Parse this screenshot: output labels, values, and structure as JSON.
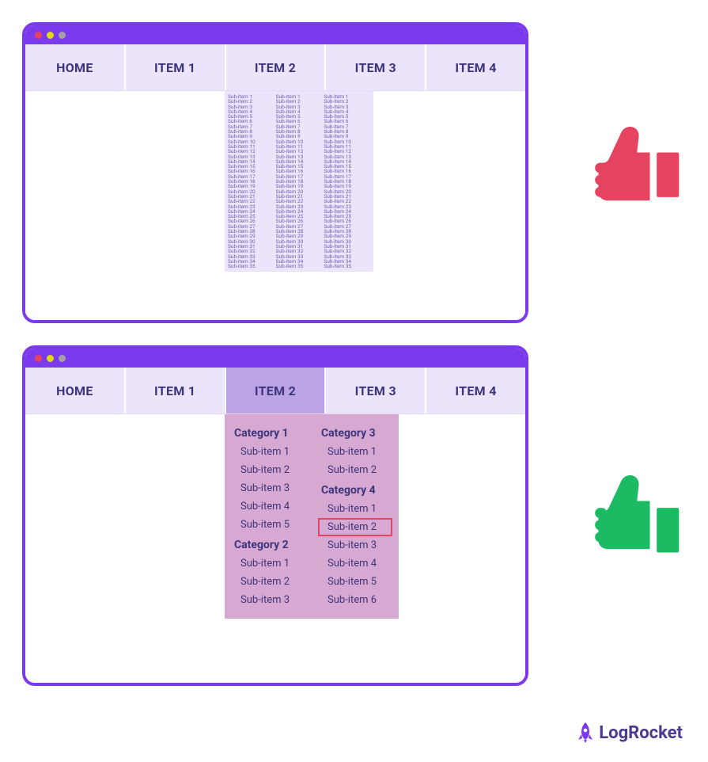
{
  "colors": {
    "window_border": "#7c3aed",
    "titlebar": "#7c3aed",
    "nav_bg": "#ece4fb",
    "nav_active": "#bba3e6",
    "nav_text": "#3d357a",
    "bad_dropdown_bg": "#ece4fb",
    "mega_bg": "#d7a8d2",
    "mega_text": "#3d357a",
    "highlight_border": "#e54360",
    "thumbs_down": "#e54360",
    "thumbs_up": "#1cbb63",
    "logo": "#4c3a8f"
  },
  "window1": {
    "nav": [
      "HOME",
      "ITEM 1",
      "ITEM 2",
      "ITEM 3",
      "ITEM 4"
    ],
    "dropdown_columns": 3,
    "subitem_prefix": "Sub-item ",
    "subitem_count": 35
  },
  "window2": {
    "nav": [
      "HOME",
      "ITEM 1",
      "ITEM 2",
      "ITEM 3",
      "ITEM 4"
    ],
    "active_nav_index": 2,
    "mega": {
      "left_col": [
        {
          "title": "Category 1",
          "items": [
            "Sub-item 1",
            "Sub-item 2",
            "Sub-item 3",
            "Sub-item 4",
            "Sub-item 5"
          ]
        },
        {
          "title": "Category 2",
          "items": [
            "Sub-item 1",
            "Sub-item 2",
            "Sub-item 3"
          ]
        }
      ],
      "right_col": [
        {
          "title": "Category 3",
          "items": [
            "Sub-item 1",
            "Sub-item 2"
          ]
        },
        {
          "title": "Category 4",
          "items": [
            "Sub-item 1",
            "Sub-item 2",
            "Sub-item 3",
            "Sub-item 4",
            "Sub-item 5",
            "Sub-item 6"
          ],
          "highlight_index": 1
        }
      ]
    }
  },
  "verdicts": {
    "top": "bad",
    "bottom": "good"
  },
  "logo": {
    "text": "LogRocket"
  }
}
